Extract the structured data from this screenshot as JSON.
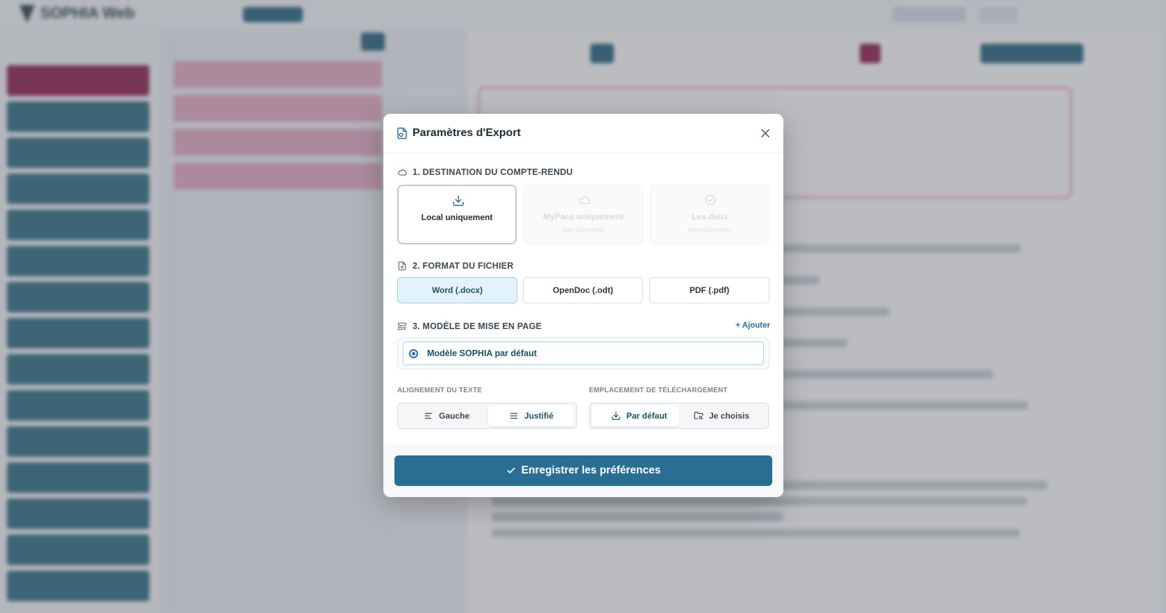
{
  "background": {
    "app_name": "SOPHIA Web"
  },
  "modal": {
    "title": "Paramètres d'Export",
    "destination": {
      "label": "1. DESTINATION DU COMPTE-RENDU",
      "options": [
        {
          "label": "Local uniquement",
          "sub": "",
          "state": "selected",
          "icon": "download-icon"
        },
        {
          "label": "MyPacs uniquement",
          "sub": "Non disponible",
          "state": "disabled",
          "icon": "cloud-icon"
        },
        {
          "label": "Les deux",
          "sub": "Non disponible",
          "state": "disabled",
          "icon": "check-circle-icon"
        }
      ]
    },
    "format": {
      "label": "2. FORMAT DU FICHIER",
      "options": [
        {
          "label": "Word (.docx)",
          "state": "selected"
        },
        {
          "label": "OpenDoc (.odt)",
          "state": "default"
        },
        {
          "label": "PDF (.pdf)",
          "state": "default"
        }
      ]
    },
    "template": {
      "label": "3. MODÈLE DE MISE EN PAGE",
      "add_label": "+ Ajouter",
      "selected": "Modèle SOPHIA par défaut"
    },
    "alignment": {
      "label": "ALIGNEMENT DU TEXTE",
      "left": "Gauche",
      "justify": "Justifié",
      "active": "justify"
    },
    "download": {
      "label": "EMPLACEMENT DE TÉLÉCHARGEMENT",
      "default": "Par défaut",
      "choose": "Je choisis",
      "active": "default"
    },
    "save_label": "Enregistrer les préférences"
  },
  "colors": {
    "primary": "#2a6f93",
    "selected_border": "#b9c8ea",
    "selected_fill": "#e3f3fb",
    "sidebar": "#2a6a80",
    "sidebar_active": "#8d1848"
  }
}
